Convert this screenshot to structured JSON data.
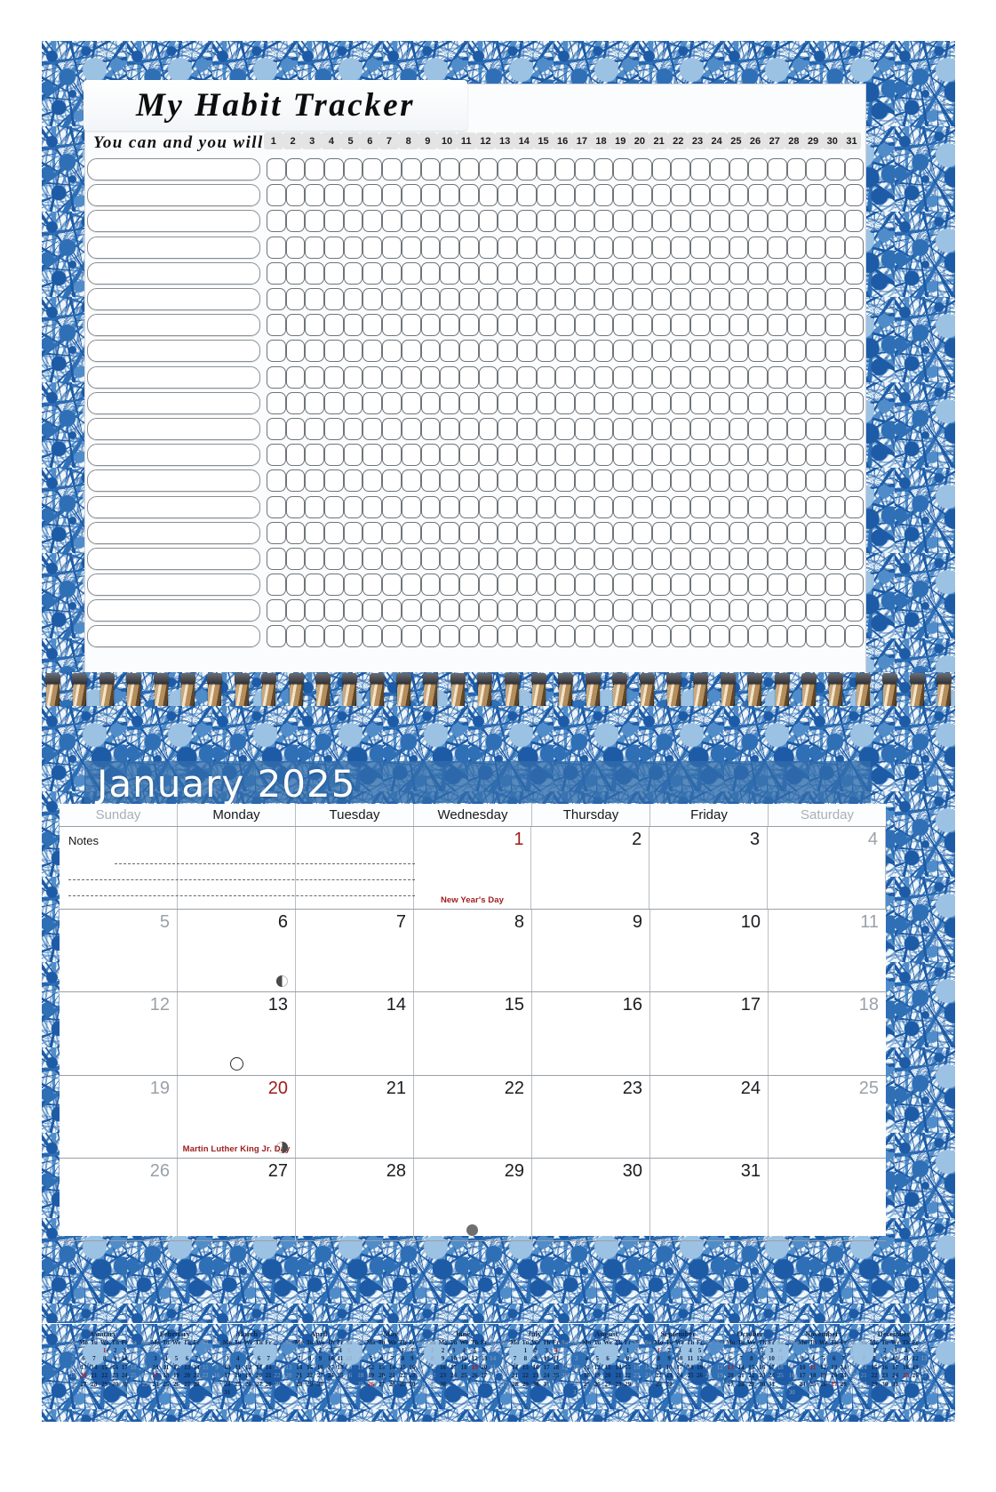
{
  "document": {
    "kind": "wall-calendar",
    "theme_accent": "#1d5ba6",
    "theme_accent_light": "#9cc2e3",
    "holiday_color": "#9e1b1b"
  },
  "habit_tracker": {
    "title": "My Habit Tracker",
    "subtitle": "You can and you will",
    "day_numbers": [
      1,
      2,
      3,
      4,
      5,
      6,
      7,
      8,
      9,
      10,
      11,
      12,
      13,
      14,
      15,
      16,
      17,
      18,
      19,
      20,
      21,
      22,
      23,
      24,
      25,
      26,
      27,
      28,
      29,
      30,
      31
    ],
    "row_count": 19,
    "columns": 31,
    "row_label_placeholder": ""
  },
  "month": {
    "title": "January 2025",
    "name": "January",
    "year": "2025",
    "weekdays": [
      {
        "label": "Sunday",
        "weekend": true
      },
      {
        "label": "Monday",
        "weekend": false
      },
      {
        "label": "Tuesday",
        "weekend": false
      },
      {
        "label": "Wednesday",
        "weekend": false
      },
      {
        "label": "Thursday",
        "weekend": false
      },
      {
        "label": "Friday",
        "weekend": false
      },
      {
        "label": "Saturday",
        "weekend": true
      }
    ],
    "notes": {
      "label": "Notes",
      "line_count": 3
    },
    "weeks": [
      [
        {
          "num": "",
          "notes_cell": true
        },
        {
          "num": "",
          "notes_cell": true
        },
        {
          "num": "",
          "notes_cell": true
        },
        {
          "num": "1",
          "holiday": "New Year's Day",
          "holiday_num": true
        },
        {
          "num": "2"
        },
        {
          "num": "3"
        },
        {
          "num": "4",
          "dim": true
        }
      ],
      [
        {
          "num": "5",
          "dim": true
        },
        {
          "num": "6",
          "moon": "last-quarter"
        },
        {
          "num": "7"
        },
        {
          "num": "8"
        },
        {
          "num": "9"
        },
        {
          "num": "10"
        },
        {
          "num": "11",
          "dim": true
        }
      ],
      [
        {
          "num": "12",
          "dim": true
        },
        {
          "num": "13",
          "moon": "new"
        },
        {
          "num": "14"
        },
        {
          "num": "15"
        },
        {
          "num": "16"
        },
        {
          "num": "17"
        },
        {
          "num": "18",
          "dim": true
        }
      ],
      [
        {
          "num": "19",
          "dim": true
        },
        {
          "num": "20",
          "holiday": "Martin Luther King Jr. Day",
          "holiday_num": true,
          "moon": "first-quarter"
        },
        {
          "num": "21"
        },
        {
          "num": "22"
        },
        {
          "num": "23"
        },
        {
          "num": "24"
        },
        {
          "num": "25",
          "dim": true
        }
      ],
      [
        {
          "num": "26",
          "dim": true
        },
        {
          "num": "27"
        },
        {
          "num": "28"
        },
        {
          "num": "29",
          "moon": "full"
        },
        {
          "num": "30"
        },
        {
          "num": "31"
        },
        {
          "num": "",
          "dim": true
        }
      ]
    ]
  },
  "year_strip": {
    "weekday_initials": [
      "Su",
      "Mo",
      "Tu",
      "We",
      "Th",
      "Fr",
      "Sa"
    ],
    "months": [
      {
        "name": "January",
        "start": 3,
        "days": 31,
        "holidays": [
          1,
          20
        ]
      },
      {
        "name": "February",
        "start": 6,
        "days": 28,
        "holidays": [
          17
        ]
      },
      {
        "name": "March",
        "start": 6,
        "days": 31,
        "holidays": []
      },
      {
        "name": "April",
        "start": 2,
        "days": 30,
        "holidays": []
      },
      {
        "name": "May",
        "start": 4,
        "days": 31,
        "holidays": [
          26
        ]
      },
      {
        "name": "June",
        "start": 0,
        "days": 30,
        "holidays": [
          19
        ]
      },
      {
        "name": "July",
        "start": 2,
        "days": 31,
        "holidays": [
          4
        ]
      },
      {
        "name": "August",
        "start": 5,
        "days": 31,
        "holidays": []
      },
      {
        "name": "September",
        "start": 1,
        "days": 30,
        "holidays": [
          1
        ]
      },
      {
        "name": "October",
        "start": 3,
        "days": 31,
        "holidays": [
          13
        ]
      },
      {
        "name": "November",
        "start": 6,
        "days": 30,
        "holidays": [
          11,
          27
        ]
      },
      {
        "name": "December",
        "start": 1,
        "days": 31,
        "holidays": [
          25
        ]
      }
    ]
  }
}
